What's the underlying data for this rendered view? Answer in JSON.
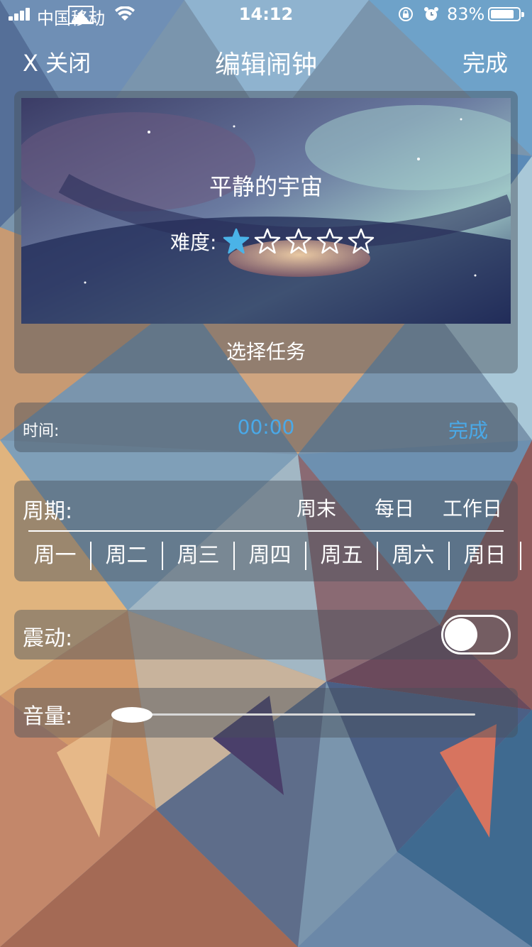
{
  "status_bar": {
    "carrier": "中国移动",
    "time": "14:12",
    "battery_percent": "83%",
    "battery_level": 0.83,
    "icons": [
      "signal-icon",
      "wifi-icon",
      "rotation-lock-icon",
      "alarm-icon",
      "battery-icon"
    ]
  },
  "nav": {
    "close_label": "X 关闭",
    "title": "编辑闹钟",
    "done_label": "完成"
  },
  "task": {
    "name": "平静的宇宙",
    "difficulty_label": "难度:",
    "difficulty_rating": 1,
    "difficulty_max": 5,
    "choose_label": "选择任务"
  },
  "time_setting": {
    "label": "时间:",
    "value": "00:00",
    "done_label": "完成"
  },
  "period": {
    "label": "周期:",
    "presets": [
      "周末",
      "每日",
      "工作日"
    ],
    "days": [
      "周一",
      "周二",
      "周三",
      "周四",
      "周五",
      "周六",
      "周日"
    ]
  },
  "vibration": {
    "label": "震动:",
    "enabled": false
  },
  "volume": {
    "label": "音量:",
    "level": 0
  },
  "colors": {
    "accent": "#4aa9e8",
    "star_filled": "#4ab3e8",
    "panel": "rgba(70,80,90,0.45)"
  }
}
